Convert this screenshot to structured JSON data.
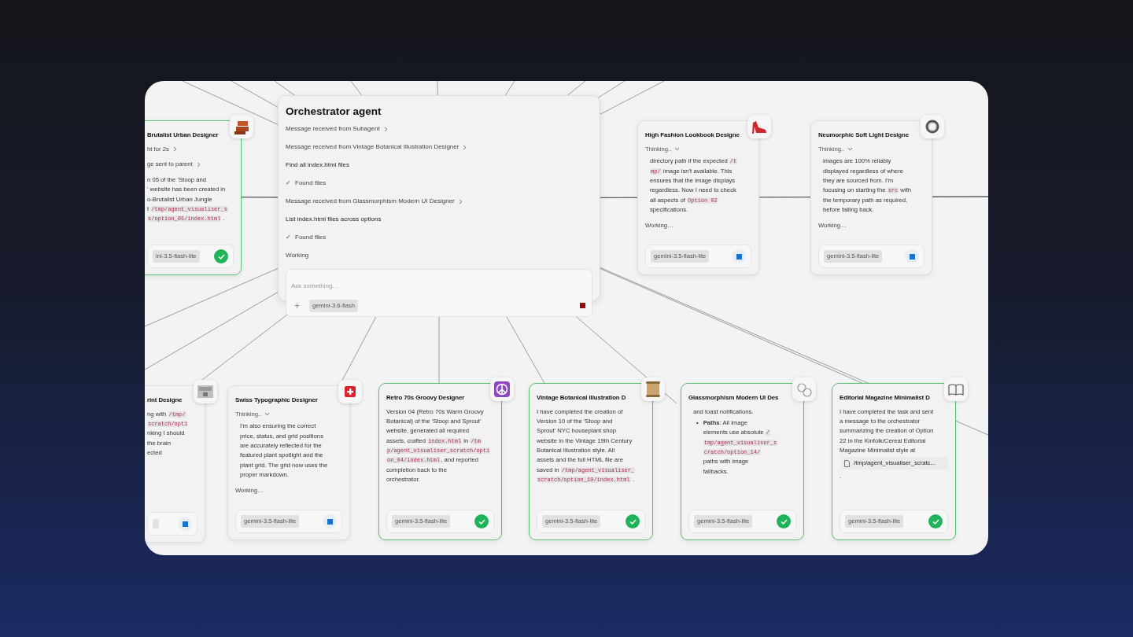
{
  "orchestrator": {
    "title": "Orchestrator agent",
    "rows": [
      {
        "kind": "message",
        "text": "Message received from Subagent"
      },
      {
        "kind": "message",
        "text": "Message received from Vintage Botanical Illustration Designer"
      },
      {
        "kind": "task",
        "text": "Find all index.html files"
      },
      {
        "kind": "result",
        "mark": "✓",
        "text": "Found files"
      },
      {
        "kind": "message",
        "text": "Message received from Glassmorphism Modern UI Designer"
      },
      {
        "kind": "task",
        "text": "List index.html files across options"
      },
      {
        "kind": "result",
        "mark": "✓",
        "text": "Found files"
      },
      {
        "kind": "status",
        "text": "Working"
      }
    ],
    "composer": {
      "placeholder": "Ask something...",
      "add": "+",
      "model": "gemini-3.6-flash",
      "running": true
    }
  },
  "agents": [
    {
      "title": "Brutalist Urban Designer",
      "completed": true,
      "indented": false,
      "steps": [
        "ht for 2s",
        "ge sent to parent"
      ],
      "blocks": [
        {
          "kind": "para",
          "lines": [
            [
              {
                "kind": "text",
                "text": "n 05 of the 'Stoop and"
              }
            ],
            [
              {
                "kind": "text",
                "text": "' website has been created in"
              }
            ],
            [
              {
                "kind": "text",
                "text": "o-Brutalist Urban Jungle"
              }
            ],
            [
              {
                "kind": "text",
                "text": "t "
              },
              {
                "kind": "code",
                "text": "/tmp/agent_visualiser_s"
              }
            ],
            [
              {
                "kind": "code",
                "text": "s/option_05/index.html"
              },
              {
                "kind": "text",
                "text": " ."
              }
            ]
          ]
        }
      ],
      "model": "ini-3.5-flash-lite"
    },
    {
      "title": "High Fashion Lookbook Designe",
      "completed": false,
      "indented": true,
      "thinking": {
        "label": "Thinking..",
        "expanded": true
      },
      "blocks": [
        {
          "kind": "para",
          "lines": [
            [
              {
                "kind": "text",
                "text": "directory path if the expected "
              },
              {
                "kind": "code",
                "text": "/t"
              }
            ],
            [
              {
                "kind": "code",
                "text": "mp/"
              },
              {
                "kind": "text",
                "text": " image isn't available. This"
              }
            ],
            [
              {
                "kind": "text",
                "text": "ensures that the image displays"
              }
            ],
            [
              {
                "kind": "text",
                "text": "regardless. Now I need to check"
              }
            ],
            [
              {
                "kind": "text",
                "text": "all aspects of "
              },
              {
                "kind": "code",
                "text": "Option 02"
              }
            ],
            [
              {
                "kind": "text",
                "text": "specifications."
              }
            ]
          ]
        }
      ],
      "activity": "Working…",
      "model": "gemini-3.5-flash-lite"
    },
    {
      "title": "Neumorphic Soft Light Designe",
      "completed": false,
      "indented": true,
      "thinking": {
        "label": "Thinking..",
        "expanded": true
      },
      "blocks": [
        {
          "kind": "para",
          "lines": [
            [
              {
                "kind": "text",
                "text": "images are 100% reliably"
              }
            ],
            [
              {
                "kind": "text",
                "text": "displayed regardless of where"
              }
            ],
            [
              {
                "kind": "text",
                "text": "they are sourced from. I'm"
              }
            ],
            [
              {
                "kind": "text",
                "text": "focusing on starting the "
              },
              {
                "kind": "code",
                "text": "src"
              },
              {
                "kind": "text",
                "text": " with"
              }
            ],
            [
              {
                "kind": "text",
                "text": "the temporary path as required,"
              }
            ],
            [
              {
                "kind": "text",
                "text": "before falling back."
              }
            ]
          ]
        }
      ],
      "activity": "Working…",
      "model": "gemini-3.5-flash-lite"
    },
    {
      "title": "rint Designe",
      "completed": false,
      "indented": false,
      "blocks": [
        {
          "kind": "para",
          "lines": [
            [
              {
                "kind": "text",
                "text": "ng with "
              },
              {
                "kind": "code",
                "text": "/tmp/"
              }
            ],
            [
              {
                "kind": "code",
                "text": "scratch/opti"
              }
            ],
            [
              {
                "kind": "text",
                "text": "nking I should"
              }
            ],
            [
              {
                "kind": "text",
                "text": "the brain"
              }
            ],
            [
              {
                "kind": "text",
                "text": "ected"
              }
            ]
          ]
        }
      ]
    },
    {
      "title": "Swiss Typographic Designer",
      "completed": false,
      "indented": true,
      "thinking": {
        "label": "Thinking..",
        "expanded": true
      },
      "blocks": [
        {
          "kind": "para",
          "lines": [
            [
              {
                "kind": "text",
                "text": "I'm also ensuring the correct"
              }
            ],
            [
              {
                "kind": "text",
                "text": "price, status, and grid positions"
              }
            ],
            [
              {
                "kind": "text",
                "text": "are accurately reflected for the"
              }
            ],
            [
              {
                "kind": "text",
                "text": "featured plant spotlight and the"
              }
            ],
            [
              {
                "kind": "text",
                "text": "plant grid. The grid now uses the"
              }
            ],
            [
              {
                "kind": "text",
                "text": "proper markdown."
              }
            ]
          ]
        }
      ],
      "activity": "Working…",
      "model": "gemini-3.5-flash-lite"
    },
    {
      "title": "Retro 70s Groovy Designer",
      "completed": true,
      "indented": false,
      "blocks": [
        {
          "kind": "para",
          "lines": [
            [
              {
                "kind": "text",
                "text": "Version 04 (Retro 70s Warm Groovy"
              }
            ],
            [
              {
                "kind": "text",
                "text": "Botanical) of the 'Stoop and Sprout'"
              }
            ],
            [
              {
                "kind": "text",
                "text": "website, generated all required"
              }
            ],
            [
              {
                "kind": "text",
                "text": "assets, crafted "
              },
              {
                "kind": "code",
                "text": "index.html"
              },
              {
                "kind": "text",
                "text": " in "
              },
              {
                "kind": "code",
                "text": "/tm"
              }
            ],
            [
              {
                "kind": "code",
                "text": "p/agent_visualiser_scratch/opti"
              }
            ],
            [
              {
                "kind": "code",
                "text": "on_04/index.html"
              },
              {
                "kind": "text",
                "text": ", and reported"
              }
            ],
            [
              {
                "kind": "text",
                "text": "completion back to the"
              }
            ],
            [
              {
                "kind": "text",
                "text": "orchestrator."
              }
            ]
          ]
        }
      ],
      "model": "gemini-3.5-flash-lite"
    },
    {
      "title": "Vintage Botanical Illustration D",
      "completed": true,
      "indented": false,
      "blocks": [
        {
          "kind": "para",
          "lines": [
            [
              {
                "kind": "text",
                "text": "I have completed the creation of"
              }
            ],
            [
              {
                "kind": "text",
                "text": "Version 10 of the 'Stoop and"
              }
            ],
            [
              {
                "kind": "text",
                "text": "Sprout' NYC houseplant shop"
              }
            ],
            [
              {
                "kind": "text",
                "text": "website in the Vintage 19th Century"
              }
            ],
            [
              {
                "kind": "text",
                "text": "Botanical Illustration style. All"
              }
            ],
            [
              {
                "kind": "text",
                "text": "assets and the full HTML file are"
              }
            ],
            [
              {
                "kind": "text",
                "text": "saved in "
              },
              {
                "kind": "code",
                "text": "/tmp/agent_visualiser_"
              }
            ],
            [
              {
                "kind": "code",
                "text": "scratch/option_10/index.html"
              },
              {
                "kind": "text",
                "text": " ."
              }
            ]
          ]
        }
      ],
      "model": "gemini-3.5-flash-lite"
    },
    {
      "title": "Glassmorphism Modern UI Des",
      "completed": true,
      "indented": true,
      "blocks": [
        {
          "kind": "para",
          "lines": [
            [
              {
                "kind": "text",
                "text": "and toast notifications."
              }
            ]
          ]
        },
        {
          "kind": "bullet",
          "marker": "•",
          "lines": [
            [
              {
                "kind": "bold",
                "text": "Paths"
              },
              {
                "kind": "text",
                "text": ": All image"
              }
            ],
            [
              {
                "kind": "text",
                "text": "elements use absolute "
              },
              {
                "kind": "code",
                "text": "/"
              }
            ],
            [
              {
                "kind": "code",
                "text": "tmp/agent_visualiser_s"
              }
            ],
            [
              {
                "kind": "code",
                "text": "cratch/option_14/"
              }
            ],
            [
              {
                "kind": "text",
                "text": "paths with image"
              }
            ],
            [
              {
                "kind": "text",
                "text": "fallbacks."
              }
            ]
          ]
        }
      ],
      "model": "gemini-3.5-flash-lite"
    },
    {
      "title": "Editorial Magazine Minimalist D",
      "completed": true,
      "indented": false,
      "blocks": [
        {
          "kind": "para",
          "lines": [
            [
              {
                "kind": "text",
                "text": "I have completed the task and sent"
              }
            ],
            [
              {
                "kind": "text",
                "text": "a message to the orchestrator"
              }
            ],
            [
              {
                "kind": "text",
                "text": "summarizing the creation of Option"
              }
            ],
            [
              {
                "kind": "text",
                "text": "22 in the Kinfolk/Cereal Editorial"
              }
            ],
            [
              {
                "kind": "text",
                "text": "Magazine Minimalist style at"
              }
            ]
          ]
        },
        {
          "kind": "file",
          "text": "/tmp/agent_visualiser_scratc..."
        },
        {
          "kind": "para",
          "lines": [
            [
              {
                "kind": "text",
                "text": "."
              }
            ]
          ]
        }
      ],
      "model": "gemini-3.5-flash-lite"
    }
  ]
}
